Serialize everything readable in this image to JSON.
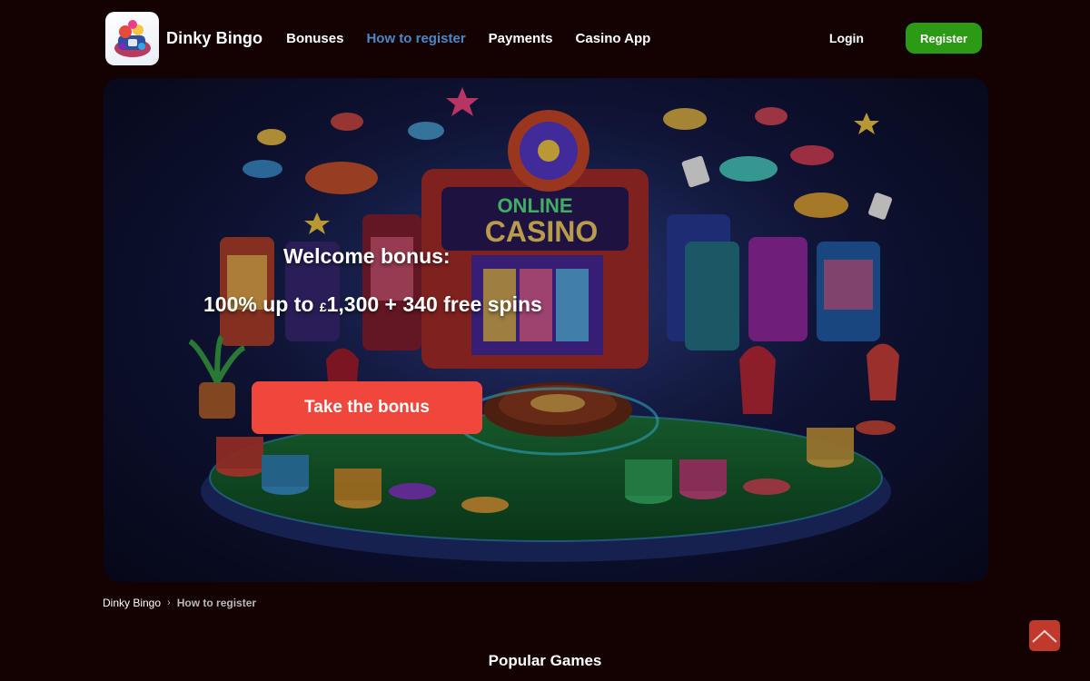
{
  "header": {
    "brand": "Dinky Bingo",
    "nav": [
      {
        "label": "Bonuses",
        "active": false
      },
      {
        "label": "How to register",
        "active": true
      },
      {
        "label": "Payments",
        "active": false
      },
      {
        "label": "Casino App",
        "active": false
      }
    ],
    "login_label": "Login",
    "register_label": "Register"
  },
  "hero": {
    "title": "Welcome bonus:",
    "offer_prefix": "100% up to ",
    "offer_currency": "£",
    "offer_rest": "1,300 + 340 free spins",
    "cta_label": "Take the bonus",
    "sign_top": "ONLINE",
    "sign_bottom": "CASINO"
  },
  "breadcrumb": {
    "home": "Dinky Bingo",
    "separator": "›",
    "current": "How to register"
  },
  "section": {
    "title": "Popular Games"
  },
  "colors": {
    "background": "#140203",
    "nav_active": "#4f86c4",
    "register_bg": "#2c9a14",
    "cta_bg": "#f0473c",
    "scroll_top_bg": "#c0392b"
  },
  "icons": {
    "logo": "dinky-bingo-logo-icon",
    "scroll_top": "chevron-up-icon"
  }
}
